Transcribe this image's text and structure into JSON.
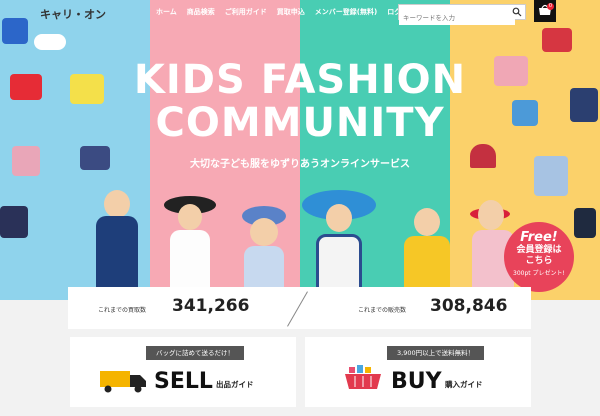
{
  "header": {
    "logo": "キャリ・オン",
    "nav": [
      "ホーム",
      "商品検索",
      "ご利用ガイド",
      "買取申込",
      "メンバー登録(無料)",
      "ログイン"
    ],
    "search_placeholder": "キーワードを入力",
    "cart_count": "0"
  },
  "hero": {
    "title_line1": "KIDS FASHION",
    "title_line2": "COMMUNITY",
    "subtitle": "大切な子ども服をゆずりあうオンラインサービス",
    "colors": [
      "#8fd3ec",
      "#f7a9b4",
      "#49cdb3",
      "#fbd16a"
    ]
  },
  "promo": {
    "free": "Free!",
    "line1": "会員登録は",
    "line2": "こちら",
    "line3": "300pt プレゼント!"
  },
  "stats": {
    "buy_label": "これまでの買取数",
    "buy_value": "341,266",
    "sell_label": "これまでの販売数",
    "sell_value": "308,846"
  },
  "sell_card": {
    "tag": "バッグに詰めて送るだけ！",
    "title": "SELL",
    "subtitle": "出品ガイド"
  },
  "buy_card": {
    "tag": "3,900円以上で送料無料！",
    "title": "BUY",
    "subtitle": "購入ガイド"
  }
}
